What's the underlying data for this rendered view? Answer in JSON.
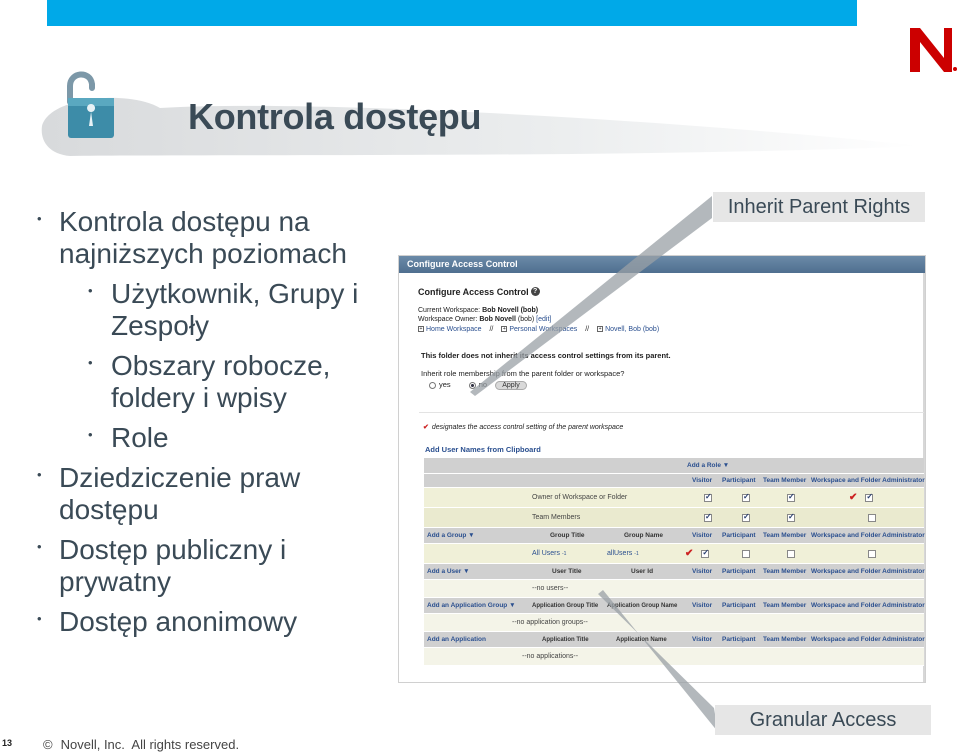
{
  "slide": {
    "title": "Kontrola dostępu",
    "page_number": "13",
    "copyright_symbol": "©",
    "copyright": "Novell, Inc.  All rights reserved.",
    "brand_color": "#00a9e8",
    "logo_color": "#cc0000"
  },
  "bullets": [
    {
      "level": 1,
      "text": "Kontrola dostępu na najniższych poziomach"
    },
    {
      "level": 2,
      "text": "Użytkownik, Grupy i Zespoły"
    },
    {
      "level": 2,
      "text": "Obszary robocze, foldery i wpisy"
    },
    {
      "level": 2,
      "text": "Role"
    },
    {
      "level": 1,
      "text": "Dziedziczenie praw dostępu"
    },
    {
      "level": 1,
      "text": "Dostęp publiczny i prywatny"
    },
    {
      "level": 1,
      "text": "Dostęp anonimowy"
    }
  ],
  "callouts": {
    "inherit": "Inherit Parent Rights",
    "granular": "Granular Access"
  },
  "screenshot": {
    "header": "Configure Access Control",
    "title": "Configure Access Control",
    "help_glyph": "?",
    "current_workspace_label": "Current Workspace:",
    "current_workspace_value": "Bob Novell (bob)",
    "owner_label": "Workspace Owner:",
    "owner_value": "Bob Novell",
    "owner_id": "(bob)",
    "edit_link": "[edit]",
    "breadcrumb": [
      "Home Workspace",
      "Personal Workspaces",
      "Novell, Bob (bob)"
    ],
    "breadcrumb_sep": "//",
    "notice": "This folder does not inherit its access control settings from its parent.",
    "question": "Inherit role membership from the parent folder or workspace?",
    "yes_label": "yes",
    "no_label": "no",
    "selected": "no",
    "apply_label": "Apply",
    "legend_check": "✔",
    "legend": "designates the access control setting of the parent workspace",
    "clipboard_link": "Add User Names from Clipboard",
    "add_role": "Add a Role ▼",
    "roles": [
      "Visitor",
      "Participant",
      "Team Member",
      "Workspace and Folder Administrator"
    ],
    "role_rows": [
      {
        "label": "Owner of Workspace or Folder",
        "checks": [
          true,
          true,
          true,
          true
        ],
        "parent_marks": [
          false,
          false,
          false,
          true
        ]
      },
      {
        "label": "Team Members",
        "checks": [
          true,
          true,
          true,
          false
        ],
        "parent_marks": [
          false,
          false,
          false,
          false
        ]
      }
    ],
    "groups_header": {
      "add": "Add a Group ▼",
      "col1": "Group Title",
      "col2": "Group Name"
    },
    "group_rows": [
      {
        "title": "All Users",
        "name": "allUsers",
        "sup": "-1",
        "checks": [
          true,
          false,
          false,
          false
        ],
        "parent_marks": [
          true,
          false,
          false,
          false
        ]
      }
    ],
    "users_header": {
      "add": "Add a User ▼",
      "col1": "User Title",
      "col2": "User Id"
    },
    "no_users": "--no users--",
    "appgroups_header": {
      "add": "Add an Application Group ▼",
      "col1": "Application Group Title",
      "col2": "Application Group Name"
    },
    "no_app_groups": "--no application groups--",
    "apps_header": {
      "add": "Add an Application",
      "col1": "Application Title",
      "col2": "Application Name"
    },
    "no_apps": "--no applications--"
  }
}
